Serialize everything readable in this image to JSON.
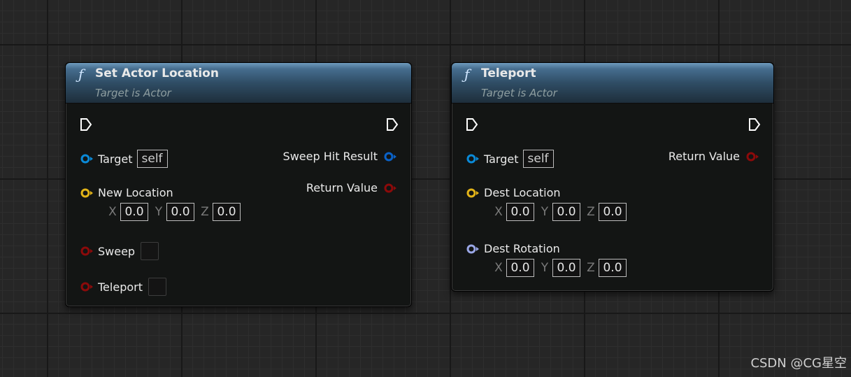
{
  "nodes": [
    {
      "title": "Set Actor Location",
      "subtitle": "Target is Actor",
      "inputs": {
        "target_label": "Target",
        "target_value": "self",
        "new_location_label": "New Location",
        "x_label": "X",
        "x_value": "0.0",
        "y_label": "Y",
        "y_value": "0.0",
        "z_label": "Z",
        "z_value": "0.0",
        "sweep_label": "Sweep",
        "teleport_label": "Teleport"
      },
      "outputs": {
        "sweep_hit_result": "Sweep Hit Result",
        "return_value": "Return Value"
      }
    },
    {
      "title": "Teleport",
      "subtitle": "Target is Actor",
      "inputs": {
        "target_label": "Target",
        "target_value": "self",
        "dest_location_label": "Dest Location",
        "loc_x_label": "X",
        "loc_x_value": "0.0",
        "loc_y_label": "Y",
        "loc_y_value": "0.0",
        "loc_z_label": "Z",
        "loc_z_value": "0.0",
        "dest_rotation_label": "Dest Rotation",
        "rot_x_label": "X",
        "rot_x_value": "0.0",
        "rot_y_label": "Y",
        "rot_y_value": "0.0",
        "rot_z_label": "Z",
        "rot_z_value": "0.0"
      },
      "outputs": {
        "return_value": "Return Value"
      }
    }
  ],
  "watermark": "CSDN @CG星空",
  "colors": {
    "object_pin": "#0a8ad8",
    "vector_pin": "#e3b418",
    "bool_pin": "#8c0a0a",
    "rotator_pin": "#9aa7e6",
    "exec_pin": "#ffffff"
  }
}
